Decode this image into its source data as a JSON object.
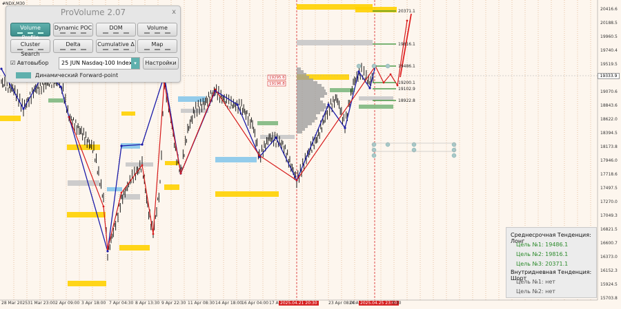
{
  "symbol": "#NDX,M30",
  "panel": {
    "title": "ProVolume 2.07",
    "close": "x",
    "buttons": [
      {
        "label": "Volume Profile",
        "active": true
      },
      {
        "label": "Dynamic POC",
        "active": false
      },
      {
        "label": "DOM",
        "active": false
      },
      {
        "label": "Volume",
        "active": false
      },
      {
        "label": "Cluster Search",
        "active": false
      },
      {
        "label": "Delta",
        "active": false
      },
      {
        "label": "Cumulative Δ",
        "active": false
      },
      {
        "label": "Map",
        "active": false
      }
    ],
    "auto_select_label": "Автовыбор",
    "instrument": "25 JUN Nasdaq-100 Index",
    "settings_label": "Настройки",
    "forward_point_label": "Динамический Forward-point"
  },
  "price_ticks": [
    "20416.6",
    "20188.5",
    "19960.5",
    "19740.4",
    "19519.5",
    "19299.7",
    "19070.6",
    "18843.6",
    "18622.0",
    "18394.5",
    "18173.8",
    "17946.0",
    "17718.6",
    "17497.5",
    "17270.0",
    "17049.3",
    "16821.5",
    "16600.7",
    "16373.0",
    "16152.3",
    "15924.5",
    "15703.8"
  ],
  "current_price": "19333.9",
  "time_ticks": [
    {
      "label": "28 Mar 2025",
      "hl": false
    },
    {
      "label": "31 Mar 23:00",
      "hl": false
    },
    {
      "label": "2 Apr 09:00",
      "hl": false
    },
    {
      "label": "3 Apr 18:00",
      "hl": false
    },
    {
      "label": "7 Apr 04:30",
      "hl": false
    },
    {
      "label": "8 Apr 13:30",
      "hl": false
    },
    {
      "label": "9 Apr 22:30",
      "hl": false
    },
    {
      "label": "11 Apr 08:30",
      "hl": false
    },
    {
      "label": "14 Apr 18:00",
      "hl": false
    },
    {
      "label": "16 Apr 04:00",
      "hl": false
    },
    {
      "label": "17 A",
      "hl": false
    },
    {
      "label": "2025.04.21 20:30",
      "hl": true
    },
    {
      "label": "23 Apr 08:00",
      "hl": false
    },
    {
      "label": "24 A",
      "hl": false
    },
    {
      "label": "2025.04.25 23:00",
      "hl": true
    },
    {
      "label": "3:30",
      "hl": false
    }
  ],
  "level_labels": [
    "20371.1",
    "19816.1",
    "19486.1",
    "19200.1",
    "19102.9",
    "18922.8",
    "19295.6",
    "19196.8"
  ],
  "info": {
    "midterm_title": "Среднесрочная Тенденция: Лонг",
    "t1": "Цель №1:  19486.1",
    "t2": "Цель №2:  19816.1",
    "t3": "Цель №3:  20371.1",
    "intraday_title": "Внутридневная Тенденция: Шорт",
    "s1": "Цель №1:  нет",
    "s2": "Цель №2:  нет"
  },
  "colors": {
    "long": "#2a8a2a",
    "short": "#d62020",
    "blue_wave": "#1a1aa8",
    "red_wave": "#d61a1a",
    "volume_yellow": "#ffd200",
    "volume_blue": "#87c8ea",
    "volume_gray": "#c8c8c8",
    "volume_green": "#7fb87f",
    "accent": "#5fb0ad"
  }
}
